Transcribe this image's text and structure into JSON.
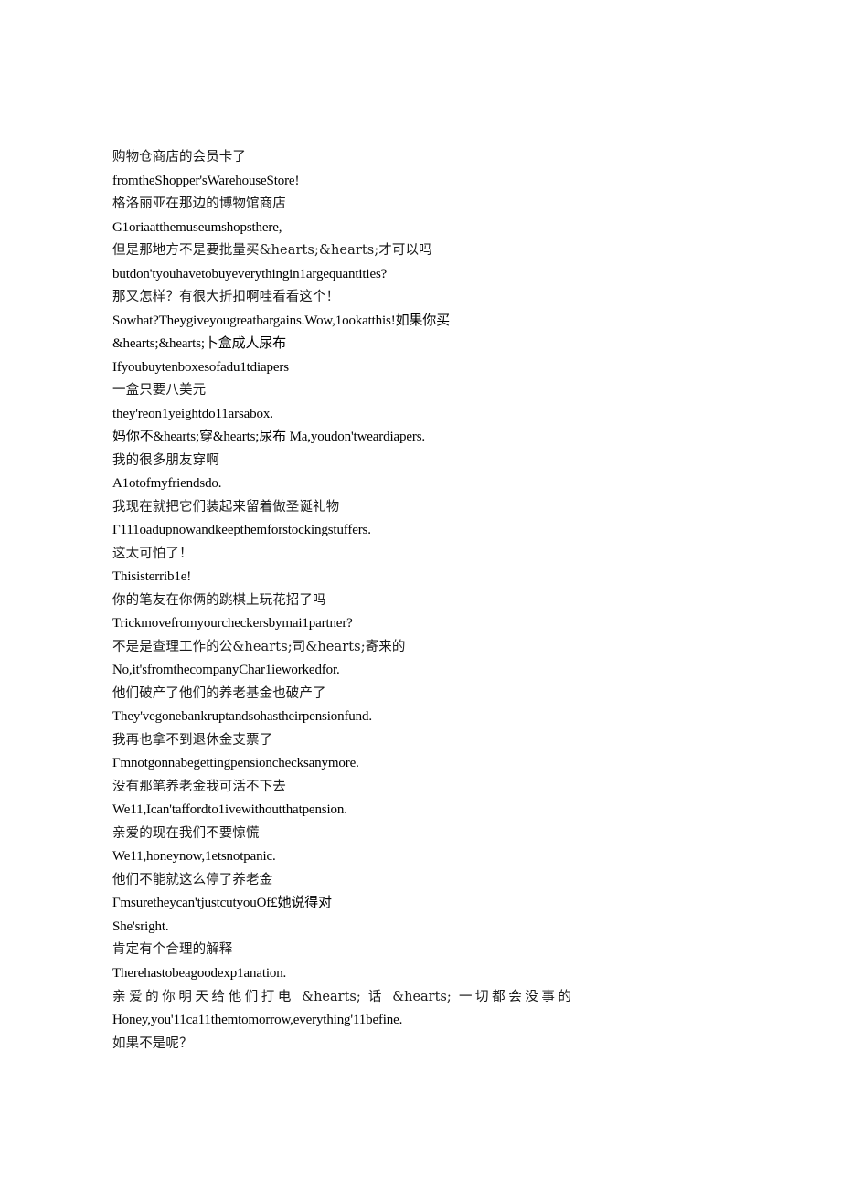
{
  "document": {
    "type": "bilingual-dialogue-transcript",
    "background_color": "#ffffff",
    "text_color": "#000000",
    "lines": [
      {
        "id": "l01",
        "script": "zh",
        "text": "购物仓商店的会员卡了"
      },
      {
        "id": "l02",
        "script": "en",
        "text": "fromtheShopper'sWarehouseStore!"
      },
      {
        "id": "l03",
        "script": "zh",
        "text": "格洛丽亚在那边的博物馆商店"
      },
      {
        "id": "l04",
        "script": "en",
        "text": "G1oriaatthemuseumshopsthere,"
      },
      {
        "id": "l05",
        "script": "zh",
        "text": "但是那地方不是要批量买&hearts;&hearts;才可以吗"
      },
      {
        "id": "l06",
        "script": "en",
        "text": "butdon'tyouhavetobuyeverythingin1argequantities?"
      },
      {
        "id": "l07",
        "script": "zh",
        "text": "那又怎样？有很大折扣啊哇看看这个！"
      },
      {
        "id": "l08",
        "script": "mixed",
        "text": "Sowhat?Theygiveyougreatbargains.Wow,1ookatthis!如果你买"
      },
      {
        "id": "l09",
        "script": "mixed",
        "text": "&hearts;&hearts;卜盒成人尿布"
      },
      {
        "id": "l10",
        "script": "en",
        "text": "Ifyoubuytenboxesofadu1tdiapers"
      },
      {
        "id": "l11",
        "script": "zh",
        "text": "一盒只要八美元"
      },
      {
        "id": "l12",
        "script": "en",
        "text": "they'reon1yeightdo11arsabox."
      },
      {
        "id": "l13",
        "script": "mixed",
        "text": "妈你不&hearts;穿&hearts;尿布 Ma,youdon'tweardiapers."
      },
      {
        "id": "l14",
        "script": "zh",
        "text": "我的很多朋友穿啊"
      },
      {
        "id": "l15",
        "script": "en",
        "text": "A1otofmyfriendsdo."
      },
      {
        "id": "l16",
        "script": "zh",
        "text": "我现在就把它们装起来留着做圣诞礼物"
      },
      {
        "id": "l17",
        "script": "en",
        "text": "Г111oadupnowandkeepthemforstockingstuffers."
      },
      {
        "id": "l18",
        "script": "zh",
        "text": "这太可怕了！"
      },
      {
        "id": "l19",
        "script": "en",
        "text": "Thisisterrib1e!"
      },
      {
        "id": "l20",
        "script": "zh",
        "text": "你的笔友在你俩的跳棋上玩花招了吗"
      },
      {
        "id": "l21",
        "script": "en",
        "text": "Trickmovefromyourcheckersbymai1partner?"
      },
      {
        "id": "l22",
        "script": "zh",
        "text": "不是是查理工作的公&hearts;司&hearts;寄来的"
      },
      {
        "id": "l23",
        "script": "en",
        "text": "No,it'sfromthecompanyChar1ieworkedfor."
      },
      {
        "id": "l24",
        "script": "zh",
        "text": "他们破产了他们的养老基金也破产了"
      },
      {
        "id": "l25",
        "script": "en",
        "text": "They'vegonebankruptandsohastheirpensionfund."
      },
      {
        "id": "l26",
        "script": "zh",
        "text": "我再也拿不到退休金支票了"
      },
      {
        "id": "l27",
        "script": "en",
        "text": "Гmnotgonnabegettingpensionchecksanymore."
      },
      {
        "id": "l28",
        "script": "zh",
        "text": "没有那笔养老金我可活不下去"
      },
      {
        "id": "l29",
        "script": "en",
        "text": "We11,Ican'taffordto1ivewithoutthatpension."
      },
      {
        "id": "l30",
        "script": "zh",
        "text": "亲爱的现在我们不要惊慌"
      },
      {
        "id": "l31",
        "script": "en",
        "text": "We11,honeynow,1etsnotpanic."
      },
      {
        "id": "l32",
        "script": "zh",
        "text": "他们不能就这么停了养老金"
      },
      {
        "id": "l33",
        "script": "mixed",
        "text": "Гmsuretheycan'tjustcutyouOf£她说得对"
      },
      {
        "id": "l34",
        "script": "en",
        "text": "She'sright."
      },
      {
        "id": "l35",
        "script": "zh",
        "text": "肯定有个合理的解释"
      },
      {
        "id": "l36",
        "script": "en",
        "text": "Therehastobeagoodexp1anation."
      },
      {
        "id": "l37",
        "script": "justified",
        "text": "亲爱的你明天给他们打电 &hearts; 话 &hearts; 一切都会没事的"
      },
      {
        "id": "l38",
        "script": "en",
        "text": "Honey,you'11ca11themtomorrow,everything'11befine."
      },
      {
        "id": "l39",
        "script": "zh",
        "text": "如果不是呢？"
      }
    ]
  }
}
